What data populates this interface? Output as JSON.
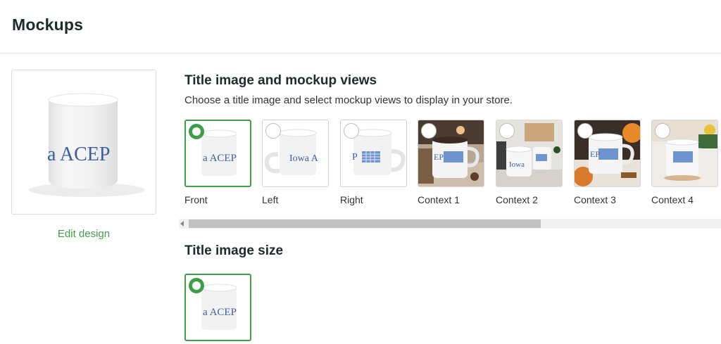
{
  "header": {
    "title": "Mockups"
  },
  "preview": {
    "mug_text": "a ACEP",
    "edit_label": "Edit design"
  },
  "mockup_views": {
    "title": "Title image and mockup views",
    "subtitle": "Choose a title image and select mockup views to display in your store.",
    "items": [
      {
        "label": "Front",
        "selected": true,
        "mug_text": "a ACEP"
      },
      {
        "label": "Left",
        "selected": false,
        "mug_text": "Iowa A"
      },
      {
        "label": "Right",
        "selected": false,
        "mug_text": "P"
      },
      {
        "label": "Context 1",
        "selected": false,
        "mug_text": "EP"
      },
      {
        "label": "Context 2",
        "selected": false,
        "mug_text": "Iowa"
      },
      {
        "label": "Context 3",
        "selected": false,
        "mug_text": "EP"
      },
      {
        "label": "Context 4",
        "selected": false,
        "mug_text": ""
      }
    ]
  },
  "title_image_size": {
    "title": "Title image size",
    "mug_text": "a ACEP"
  },
  "colors": {
    "accent": "#3f9d4a",
    "mug_text": "#3d5f9e"
  }
}
